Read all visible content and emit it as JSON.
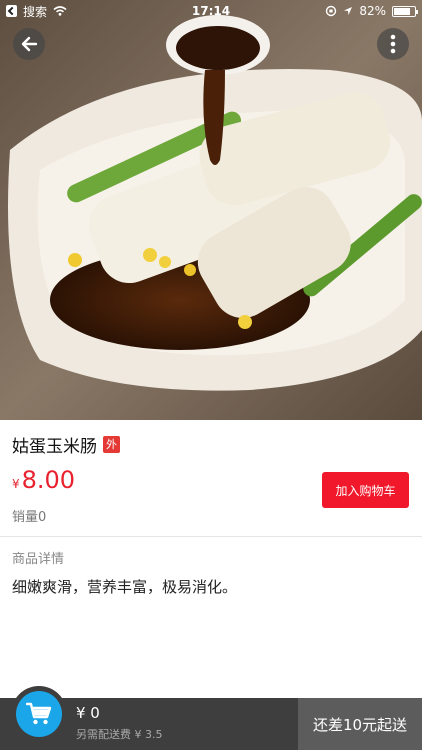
{
  "status_bar": {
    "back_label": "搜索",
    "time": "17:14",
    "battery": "82%"
  },
  "product": {
    "name": "姑蛋玉米肠",
    "tag": "外",
    "currency": "¥",
    "price": "8.00",
    "add_to_cart": "加入购物车",
    "sales": "销量0",
    "detail_title": "商品详情",
    "detail_text": "细嫩爽滑，营养丰富，极易消化。"
  },
  "cart_bar": {
    "total": "¥ 0",
    "delivery_fee": "另需配送费 ¥ 3.5",
    "submit": "还差10元起送"
  },
  "colors": {
    "price_red": "#e8232f",
    "button_red": "#f0182a",
    "cart_blue": "#1aa6e8",
    "bar_dark": "#3e3e3f"
  },
  "icons": [
    "back-arrow-icon",
    "more-vertical-icon",
    "shopping-cart-icon",
    "wifi-icon",
    "location-icon",
    "battery-icon"
  ]
}
